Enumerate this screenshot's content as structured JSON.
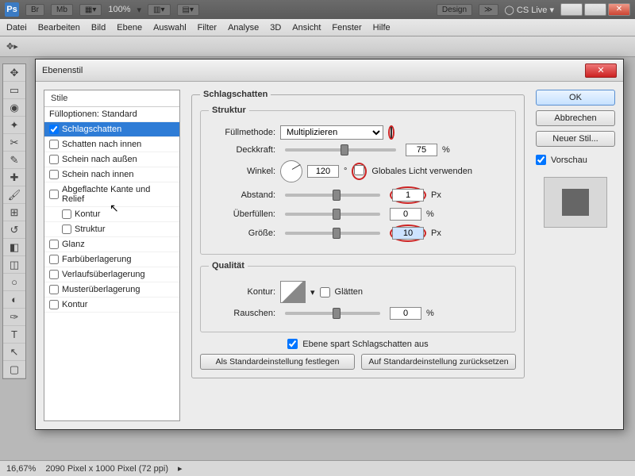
{
  "topbar": {
    "br": "Br",
    "mb": "Mb",
    "zoom": "100%",
    "design": "Design",
    "cslive": "CS Live"
  },
  "menu": [
    "Datei",
    "Bearbeiten",
    "Bild",
    "Ebene",
    "Auswahl",
    "Filter",
    "Analyse",
    "3D",
    "Ansicht",
    "Fenster",
    "Hilfe"
  ],
  "dialog": {
    "title": "Ebenenstil"
  },
  "styles": {
    "header": "Stile",
    "fullopt": "Fülloptionen: Standard",
    "items": [
      {
        "label": "Schlagschatten",
        "checked": true,
        "sel": true
      },
      {
        "label": "Schatten nach innen",
        "checked": false
      },
      {
        "label": "Schein nach außen",
        "checked": false
      },
      {
        "label": "Schein nach innen",
        "checked": false
      },
      {
        "label": "Abgeflachte Kante und Relief",
        "checked": false
      },
      {
        "label": "Kontur",
        "checked": false,
        "indent": true
      },
      {
        "label": "Struktur",
        "checked": false,
        "indent": true
      },
      {
        "label": "Glanz",
        "checked": false
      },
      {
        "label": "Farbüberlagerung",
        "checked": false
      },
      {
        "label": "Verlaufsüberlagerung",
        "checked": false
      },
      {
        "label": "Musterüberlagerung",
        "checked": false
      },
      {
        "label": "Kontur",
        "checked": false
      }
    ]
  },
  "panel": {
    "title": "Schlagschatten",
    "struktur": "Struktur",
    "fullmethode": "Füllmethode:",
    "fullmethode_val": "Multiplizieren",
    "deckkraft": "Deckkraft:",
    "deckkraft_val": "75",
    "pct": "%",
    "winkel": "Winkel:",
    "winkel_val": "120",
    "deg": "°",
    "global": "Globales Licht verwenden",
    "abstand": "Abstand:",
    "abstand_val": "1",
    "px": "Px",
    "uberf": "Überfüllen:",
    "uberf_val": "0",
    "grosse": "Größe:",
    "grosse_val": "10",
    "qualitat": "Qualität",
    "kontur": "Kontur:",
    "glatten": "Glätten",
    "rauschen": "Rauschen:",
    "rauschen_val": "0",
    "ebenespart": "Ebene spart Schlagschatten aus",
    "setdef": "Als Standardeinstellung festlegen",
    "resetdef": "Auf Standardeinstellung zurücksetzen"
  },
  "buttons": {
    "ok": "OK",
    "cancel": "Abbrechen",
    "neuer": "Neuer Stil...",
    "vorschau": "Vorschau"
  },
  "status": {
    "zoom": "16,67%",
    "doc": "2090 Pixel x 1000 Pixel (72 ppi)"
  }
}
